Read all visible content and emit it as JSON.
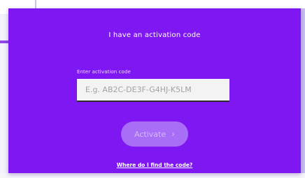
{
  "dialog": {
    "title": "I have an activation code",
    "field_label": "Enter activation code",
    "input_value": "",
    "input_placeholder": "E.g. AB2C-DE3F-G4HJ-K5LM",
    "activate_label": "Activate",
    "activate_icon": "chevron-right-icon",
    "help_link": "Where do I find the code?"
  },
  "colors": {
    "panel": "#7f17f3",
    "button": "#a86ff6",
    "input_bg": "#f3f3f3"
  }
}
